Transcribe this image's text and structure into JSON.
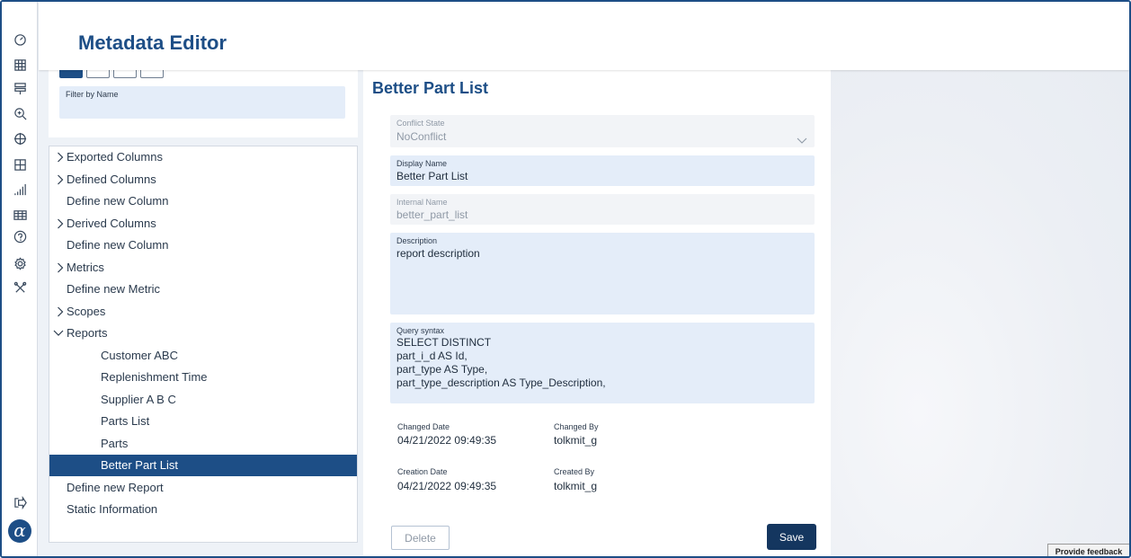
{
  "app": {
    "title": "Metadata Editor"
  },
  "rail": {
    "icons": [
      "dashboard-icon",
      "grid-icon",
      "layers-icon",
      "zoom-icon",
      "target-icon",
      "table-add-icon",
      "bar-chart-icon",
      "table-icon",
      "help-icon",
      "settings-icon",
      "tools-icon",
      "logout-icon"
    ],
    "logo": "α"
  },
  "filter": {
    "label": "Filter by Name",
    "value": ""
  },
  "tree": {
    "items": [
      {
        "label": "Exported Columns",
        "expandable": true,
        "expanded": false,
        "level": 0
      },
      {
        "label": "Defined Columns",
        "expandable": true,
        "expanded": false,
        "level": 0
      },
      {
        "label": "Define new Column",
        "expandable": false,
        "level": 0
      },
      {
        "label": "Derived Columns",
        "expandable": true,
        "expanded": false,
        "level": 0
      },
      {
        "label": "Define new Column",
        "expandable": false,
        "level": 0
      },
      {
        "label": "Metrics",
        "expandable": true,
        "expanded": false,
        "level": 0
      },
      {
        "label": "Define new Metric",
        "expandable": false,
        "level": 0
      },
      {
        "label": "Scopes",
        "expandable": true,
        "expanded": false,
        "level": 0
      },
      {
        "label": "Reports",
        "expandable": true,
        "expanded": true,
        "level": 0
      },
      {
        "label": "Customer ABC",
        "expandable": false,
        "level": 1
      },
      {
        "label": "Replenishment Time",
        "expandable": false,
        "level": 1
      },
      {
        "label": "Supplier A B C",
        "expandable": false,
        "level": 1
      },
      {
        "label": "Parts List",
        "expandable": false,
        "level": 1
      },
      {
        "label": "Parts",
        "expandable": false,
        "level": 1
      },
      {
        "label": "Better Part List",
        "expandable": false,
        "level": 1,
        "selected": true
      },
      {
        "label": "Define new Report",
        "expandable": false,
        "level": 0
      },
      {
        "label": "Static Information",
        "expandable": false,
        "level": 0
      }
    ]
  },
  "detail": {
    "title": "Better Part List",
    "conflict_state": {
      "label": "Conflict State",
      "value": "NoConflict"
    },
    "display_name": {
      "label": "Display Name",
      "value": "Better Part List"
    },
    "internal_name": {
      "label": "Internal Name",
      "value": "better_part_list"
    },
    "description": {
      "label": "Description",
      "value": "report description"
    },
    "query": {
      "label": "Query syntax",
      "lines": [
        "SELECT DISTINCT",
        "part_i_d AS Id,",
        "part_type AS Type,",
        "part_type_description AS Type_Description,"
      ]
    },
    "changed_date": {
      "label": "Changed Date",
      "value": "04/21/2022 09:49:35"
    },
    "changed_by": {
      "label": "Changed By",
      "value": "tolkmit_g"
    },
    "creation_date": {
      "label": "Creation Date",
      "value": "04/21/2022 09:49:35"
    },
    "created_by": {
      "label": "Created By",
      "value": "tolkmit_g"
    },
    "delete_label": "Delete",
    "save_label": "Save"
  },
  "feedback_label": "Provide feedback",
  "colors": {
    "brand": "#1d4e86",
    "field_bg": "#e4edf9",
    "save_bg": "#14365f"
  }
}
